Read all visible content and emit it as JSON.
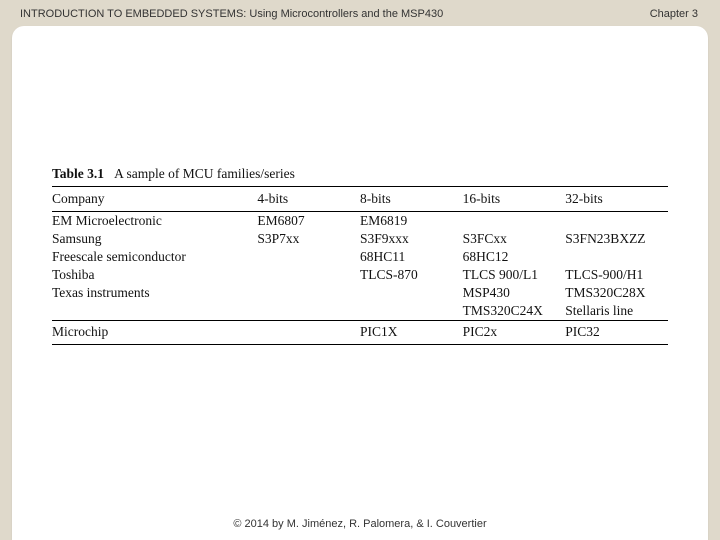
{
  "header": {
    "title_left": "INTRODUCTION TO EMBEDDED SYSTEMS: Using Microcontrollers and the MSP430",
    "title_right": "Chapter 3"
  },
  "table": {
    "label": "Table 3.1",
    "caption": "A sample of MCU families/series",
    "columns": [
      "Company",
      "4-bits",
      "8-bits",
      "16-bits",
      "32-bits"
    ],
    "rows": [
      {
        "cells": [
          "EM Microelectronic",
          "EM6807",
          "EM6819",
          "",
          ""
        ]
      },
      {
        "cells": [
          "Samsung",
          "S3P7xx",
          "S3F9xxx",
          "S3FCxx",
          "S3FN23BXZZ"
        ]
      },
      {
        "cells": [
          "Freescale semiconductor",
          "",
          "68HC11",
          "68HC12",
          ""
        ]
      },
      {
        "cells": [
          "Toshiba",
          "",
          "TLCS-870",
          "TLCS 900/L1",
          "TLCS-900/H1"
        ]
      },
      {
        "cells": [
          "Texas instruments",
          "",
          "",
          "MSP430",
          "TMS320C28X"
        ]
      },
      {
        "cells": [
          "",
          "",
          "",
          "TMS320C24X",
          "Stellaris line"
        ]
      },
      {
        "cells": [
          "Microchip",
          "",
          "PIC1X",
          "PIC2x",
          "PIC32"
        ],
        "sep": true,
        "last": true
      }
    ]
  },
  "footer": {
    "text": "© 2014 by M. Jiménez, R. Palomera, & I. Couvertier"
  }
}
